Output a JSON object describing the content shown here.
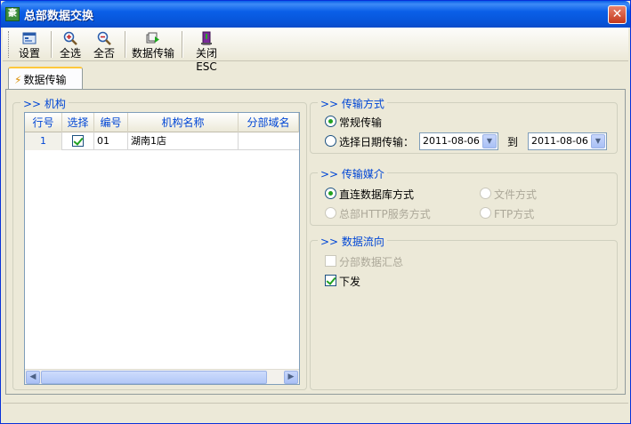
{
  "window": {
    "title": "总部数据交换",
    "icon_text": "豪",
    "close": "✕"
  },
  "toolbar": {
    "settings": "设置",
    "select_all": "全选",
    "select_none": "全否",
    "transfer": "数据传输",
    "close": "关闭ESC"
  },
  "tab": {
    "label": "数据传输"
  },
  "org_group": {
    "title": ">> 机构",
    "columns": [
      "行号",
      "选择",
      "编号",
      "机构名称",
      "分部域名"
    ],
    "rows": [
      {
        "row": "1",
        "selected": true,
        "code": "01",
        "name": "湖南1店",
        "domain": ""
      }
    ]
  },
  "transfer_mode": {
    "title": ">> 传输方式",
    "normal": "常规传输",
    "by_date": "选择日期传输：",
    "from_date": "2011-08-06",
    "to_label": "到",
    "to_date": "2011-08-06",
    "selected": "normal"
  },
  "media": {
    "title": ">> 传输媒介",
    "direct_db": "直连数据库方式",
    "file": "文件方式",
    "http": "总部HTTP服务方式",
    "ftp": "FTP方式"
  },
  "flow": {
    "title": ">> 数据流向",
    "summary": "分部数据汇总",
    "summary_checked": false,
    "download": "下发",
    "download_checked": true
  },
  "colors": {
    "accent": "#0046D5",
    "titlebar": "#0A5FE8"
  }
}
